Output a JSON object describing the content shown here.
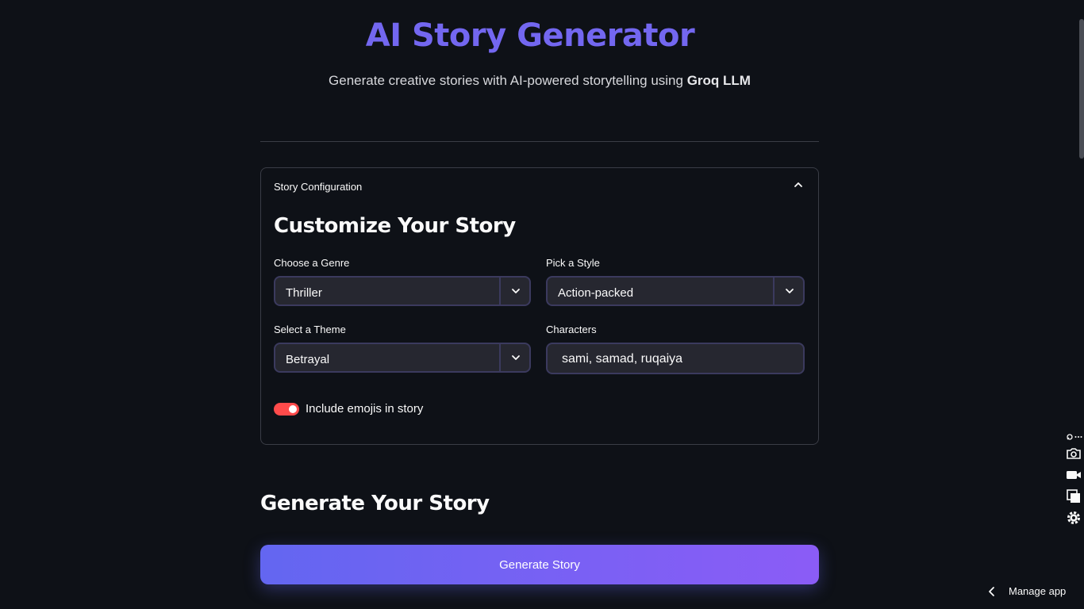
{
  "header": {
    "title": "AI Story Generator",
    "subtitle_prefix": "Generate creative stories with AI-powered storytelling using ",
    "subtitle_bold": "Groq LLM"
  },
  "config": {
    "expander_label": "Story Configuration",
    "heading": "Customize Your Story",
    "genre": {
      "label": "Choose a Genre",
      "value": "Thriller"
    },
    "style": {
      "label": "Pick a Style",
      "value": "Action-packed"
    },
    "theme": {
      "label": "Select a Theme",
      "value": "Betrayal"
    },
    "characters": {
      "label": "Characters",
      "value": "sami, samad, ruqaiya"
    },
    "emoji_toggle": {
      "label": "Include emojis in story",
      "enabled": true
    }
  },
  "generate": {
    "heading": "Generate Your Story",
    "button_label": "Generate Story"
  },
  "footer": {
    "manage_label": "Manage app"
  },
  "colors": {
    "background": "#0e1117",
    "title": "#7367f0",
    "toggle_on": "#ff4b4b",
    "button_gradient_start": "#6366f1",
    "button_gradient_end": "#8b5cf6"
  },
  "icons": {
    "expander": "chevron-up-icon",
    "select": "chevron-down-icon",
    "tools": [
      "pin-icon",
      "more-icon",
      "camera-icon",
      "video-icon",
      "copy-icon",
      "gear-icon"
    ],
    "manage": "chevron-left-icon"
  }
}
